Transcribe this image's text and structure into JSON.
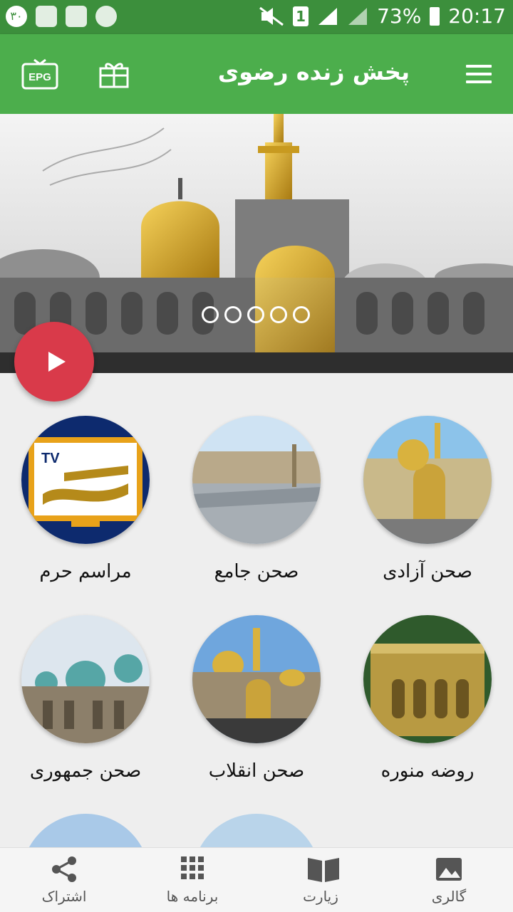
{
  "status_bar": {
    "left_icons": [
      "notification-badge-icon",
      "image-icon",
      "video-icon",
      "warning-icon"
    ],
    "badge_text": "۳۰",
    "sim": "1",
    "battery": "73%",
    "time": "20:17"
  },
  "app_bar": {
    "title": "پخش زنده رضوی",
    "epg_label": "EPG"
  },
  "banner": {
    "slides": 5,
    "active_slide": 0
  },
  "grid": {
    "items": [
      {
        "label": "صحن آزادی"
      },
      {
        "label": "صحن جامع"
      },
      {
        "label": "مراسم حرم"
      },
      {
        "label": "روضه منوره"
      },
      {
        "label": "صحن انقلاب"
      },
      {
        "label": "صحن جمهوری"
      }
    ],
    "tv_logo_text": "TV"
  },
  "bottom_nav": {
    "items": [
      {
        "label": "گالری",
        "icon": "gallery-icon"
      },
      {
        "label": "زیارت",
        "icon": "book-icon"
      },
      {
        "label": "برنامه ها",
        "icon": "grid-icon"
      },
      {
        "label": "اشتراک",
        "icon": "share-icon"
      }
    ]
  },
  "colors": {
    "app_bar": "#4cae4c",
    "status_bar": "#3c8f3c",
    "fab": "#d93a4a"
  }
}
